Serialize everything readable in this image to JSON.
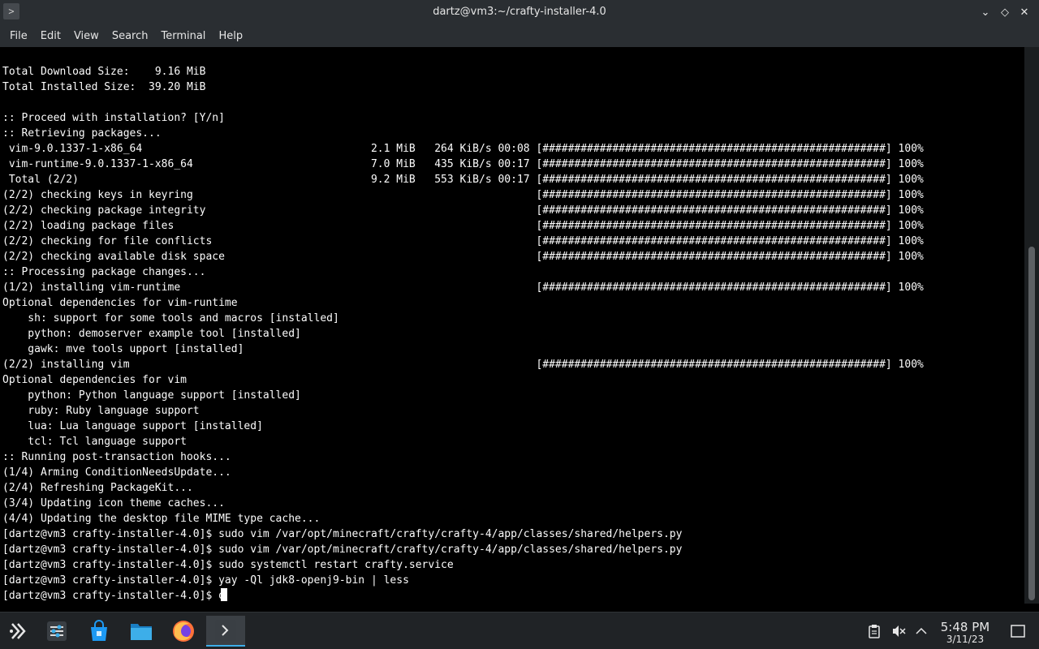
{
  "window": {
    "title": "dartz@vm3:~/crafty-installer-4.0",
    "app_icon": ">",
    "buttons": {
      "minimize": "⌄",
      "float": "◇",
      "close": "✕"
    }
  },
  "menu": {
    "items": [
      "File",
      "Edit",
      "View",
      "Search",
      "Terminal",
      "Help"
    ]
  },
  "terminal": {
    "lines": [
      "Total Download Size:    9.16 MiB",
      "Total Installed Size:  39.20 MiB",
      "",
      ":: Proceed with installation? [Y/n]",
      ":: Retrieving packages...",
      " vim-9.0.1337-1-x86_64                                    2.1 MiB   264 KiB/s 00:08 [######################################################] 100%",
      " vim-runtime-9.0.1337-1-x86_64                            7.0 MiB   435 KiB/s 00:17 [######################################################] 100%",
      " Total (2/2)                                              9.2 MiB   553 KiB/s 00:17 [######################################################] 100%",
      "(2/2) checking keys in keyring                                                      [######################################################] 100%",
      "(2/2) checking package integrity                                                    [######################################################] 100%",
      "(2/2) loading package files                                                         [######################################################] 100%",
      "(2/2) checking for file conflicts                                                   [######################################################] 100%",
      "(2/2) checking available disk space                                                 [######################################################] 100%",
      ":: Processing package changes...",
      "(1/2) installing vim-runtime                                                        [######################################################] 100%",
      "Optional dependencies for vim-runtime",
      "    sh: support for some tools and macros [installed]",
      "    python: demoserver example tool [installed]",
      "    gawk: mve tools upport [installed]",
      "(2/2) installing vim                                                                [######################################################] 100%",
      "Optional dependencies for vim",
      "    python: Python language support [installed]",
      "    ruby: Ruby language support",
      "    lua: Lua language support [installed]",
      "    tcl: Tcl language support",
      ":: Running post-transaction hooks...",
      "(1/4) Arming ConditionNeedsUpdate...",
      "(2/4) Refreshing PackageKit...",
      "(3/4) Updating icon theme caches...",
      "(4/4) Updating the desktop file MIME type cache...",
      "[dartz@vm3 crafty-installer-4.0]$ sudo vim /var/opt/minecraft/crafty/crafty-4/app/classes/shared/helpers.py",
      "[dartz@vm3 crafty-installer-4.0]$ sudo vim /var/opt/minecraft/crafty/crafty-4/app/classes/shared/helpers.py",
      "[dartz@vm3 crafty-installer-4.0]$ sudo systemctl restart crafty.service",
      "[dartz@vm3 crafty-installer-4.0]$ yay -Ql jdk8-openj9-bin | less"
    ],
    "prompt": "[dartz@vm3 crafty-installer-4.0]$ ",
    "current_input": "q"
  },
  "taskbar": {
    "launcher_icon": "app-launcher-icon",
    "apps": [
      "settings-icon",
      "discover-store-icon",
      "file-manager-icon",
      "firefox-icon",
      "terminal-icon"
    ],
    "tray": [
      "clipboard-icon",
      "volume-muted-icon",
      "tray-expand-icon"
    ],
    "time": "5:48 PM",
    "date": "3/11/23"
  },
  "colors": {
    "titlebar": "#2a2e32",
    "terminal_bg": "#000000",
    "terminal_fg": "#fcfcfc",
    "taskbar": "#202326",
    "accent": "#3daee9"
  }
}
